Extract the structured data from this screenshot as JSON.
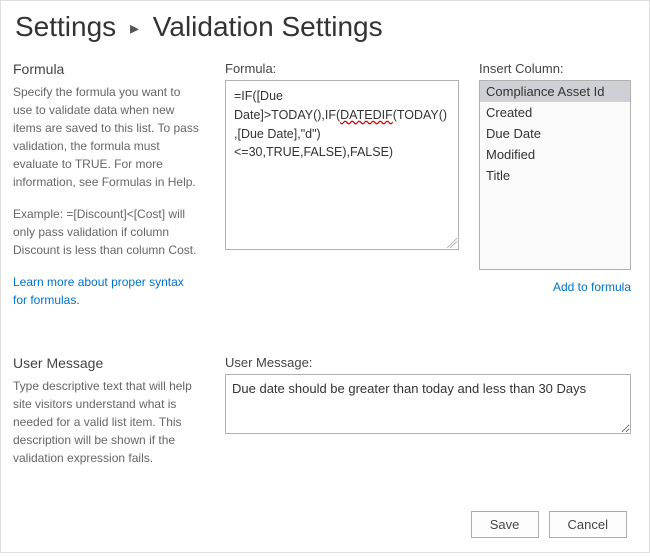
{
  "breadcrumb": {
    "root": "Settings",
    "current": "Validation Settings"
  },
  "formula_section": {
    "heading": "Formula",
    "help1": "Specify the formula you want to use to validate data when new items are saved to this list. To pass validation, the formula must evaluate to TRUE. For more information, see Formulas in Help.",
    "help2": "Example: =[Discount]<[Cost] will only pass validation if column Discount is less than column Cost.",
    "link": "Learn more about proper syntax for formulas.",
    "label": "Formula:",
    "value_pre": "=IF([Due Date]>TODAY(),IF(",
    "value_mid": "DATEDIF",
    "value_post": "(TODAY(),[Due Date],\"d\")<=30,TRUE,FALSE),FALSE)"
  },
  "insert_column": {
    "label": "Insert Column:",
    "items": [
      "Compliance Asset Id",
      "Created",
      "Due Date",
      "Modified",
      "Title"
    ],
    "selected_index": 0,
    "add_link": "Add to formula"
  },
  "user_message_section": {
    "heading": "User Message",
    "help": "Type descriptive text that will help site visitors understand what is needed for a valid list item. This description will be shown if the validation expression fails.",
    "label": "User Message:",
    "value": "Due date should be greater than today and less than 30 Days"
  },
  "buttons": {
    "save": "Save",
    "cancel": "Cancel"
  }
}
